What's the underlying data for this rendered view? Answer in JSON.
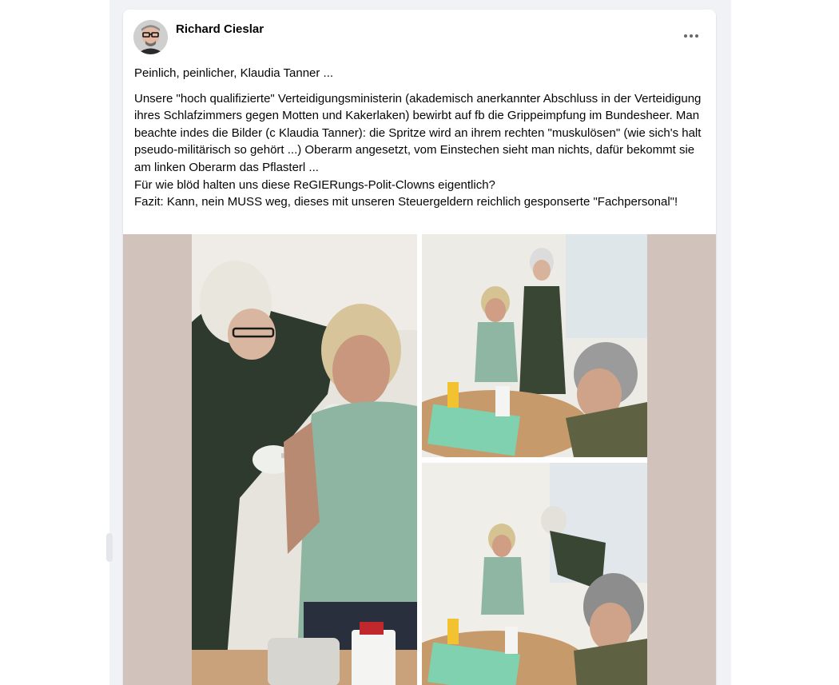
{
  "post": {
    "author": "Richard Cieslar",
    "headline": "Peinlich, peinlicher, Klaudia Tanner ...",
    "body": [
      "Unsere \"hoch qualifizierte\" Verteidigungsministerin (akademisch anerkannter Abschluss in der Verteidigung ihres Schlafzimmers gegen Motten und Kakerlaken) bewirbt auf fb die Grippeimpfung im Bundesheer. Man beachte indes die Bilder (c Klaudia Tanner): die Spritze wird an ihrem rechten \"muskulösen\" (wie sich's halt pseudo-militärisch so gehört ...) Oberarm angesetzt, vom Einstechen sieht man nichts, dafür bekommt sie am linken Oberarm das Pflasterl ...",
      "Für wie blöd halten uns diese ReGIERungs-Polit-Clowns eigentlich?",
      "Fazit: Kann, nein MUSS weg, dieses mit unseren Steuergeldern reichlich gesponserte \"Fachpersonal\"!"
    ],
    "more_icon": "more-horizontal-icon"
  },
  "colors": {
    "page_bg": "#f0f2f5",
    "card_bg": "#ffffff",
    "text": "#050505",
    "secondary_text": "#65676b",
    "media_bg": "#d2c2bc"
  }
}
